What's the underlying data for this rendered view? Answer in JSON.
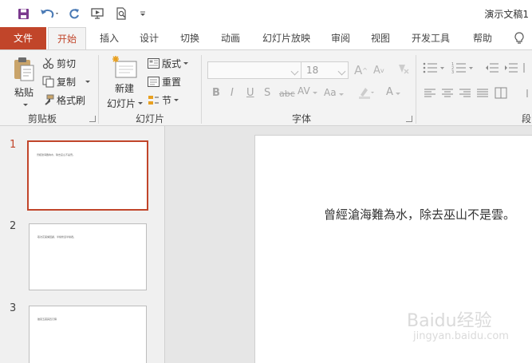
{
  "window": {
    "title": "演示文稿1"
  },
  "tabs": [
    {
      "label": "文件"
    },
    {
      "label": "开始"
    },
    {
      "label": "插入"
    },
    {
      "label": "设计"
    },
    {
      "label": "切换"
    },
    {
      "label": "动画"
    },
    {
      "label": "幻灯片放映"
    },
    {
      "label": "审阅"
    },
    {
      "label": "视图"
    },
    {
      "label": "开发工具"
    },
    {
      "label": "帮助"
    }
  ],
  "ribbon": {
    "clipboard": {
      "paste": "粘贴",
      "cut": "剪切",
      "copy": "复制",
      "format_painter": "格式刷",
      "group": "剪贴板"
    },
    "slides": {
      "new_slide_line1": "新建",
      "new_slide_line2": "幻灯片",
      "layout": "版式",
      "reset": "重置",
      "section": "节",
      "group": "幻灯片"
    },
    "font": {
      "font_size": "18",
      "group": "字体"
    },
    "paragraph": {
      "group": "段"
    }
  },
  "slides": [
    {
      "number": "1",
      "text": "曾經滄海難為水，除去巫山不是雲。"
    },
    {
      "number": "2",
      "text": "取次花叢懶回顧，半緣修道半緣君。"
    },
    {
      "number": "3",
      "text": "離思五首其四元稹"
    }
  ],
  "editor": {
    "slide_text": "曾經滄海難為水，除去巫山不是雲。"
  },
  "watermark": {
    "main": "Baidu经验",
    "sub": "jingyan.baidu.com"
  },
  "colors": {
    "accent": "#c1452a",
    "ribbon_bg": "#f3f3f3",
    "canvas_bg": "#e6e6e6"
  }
}
